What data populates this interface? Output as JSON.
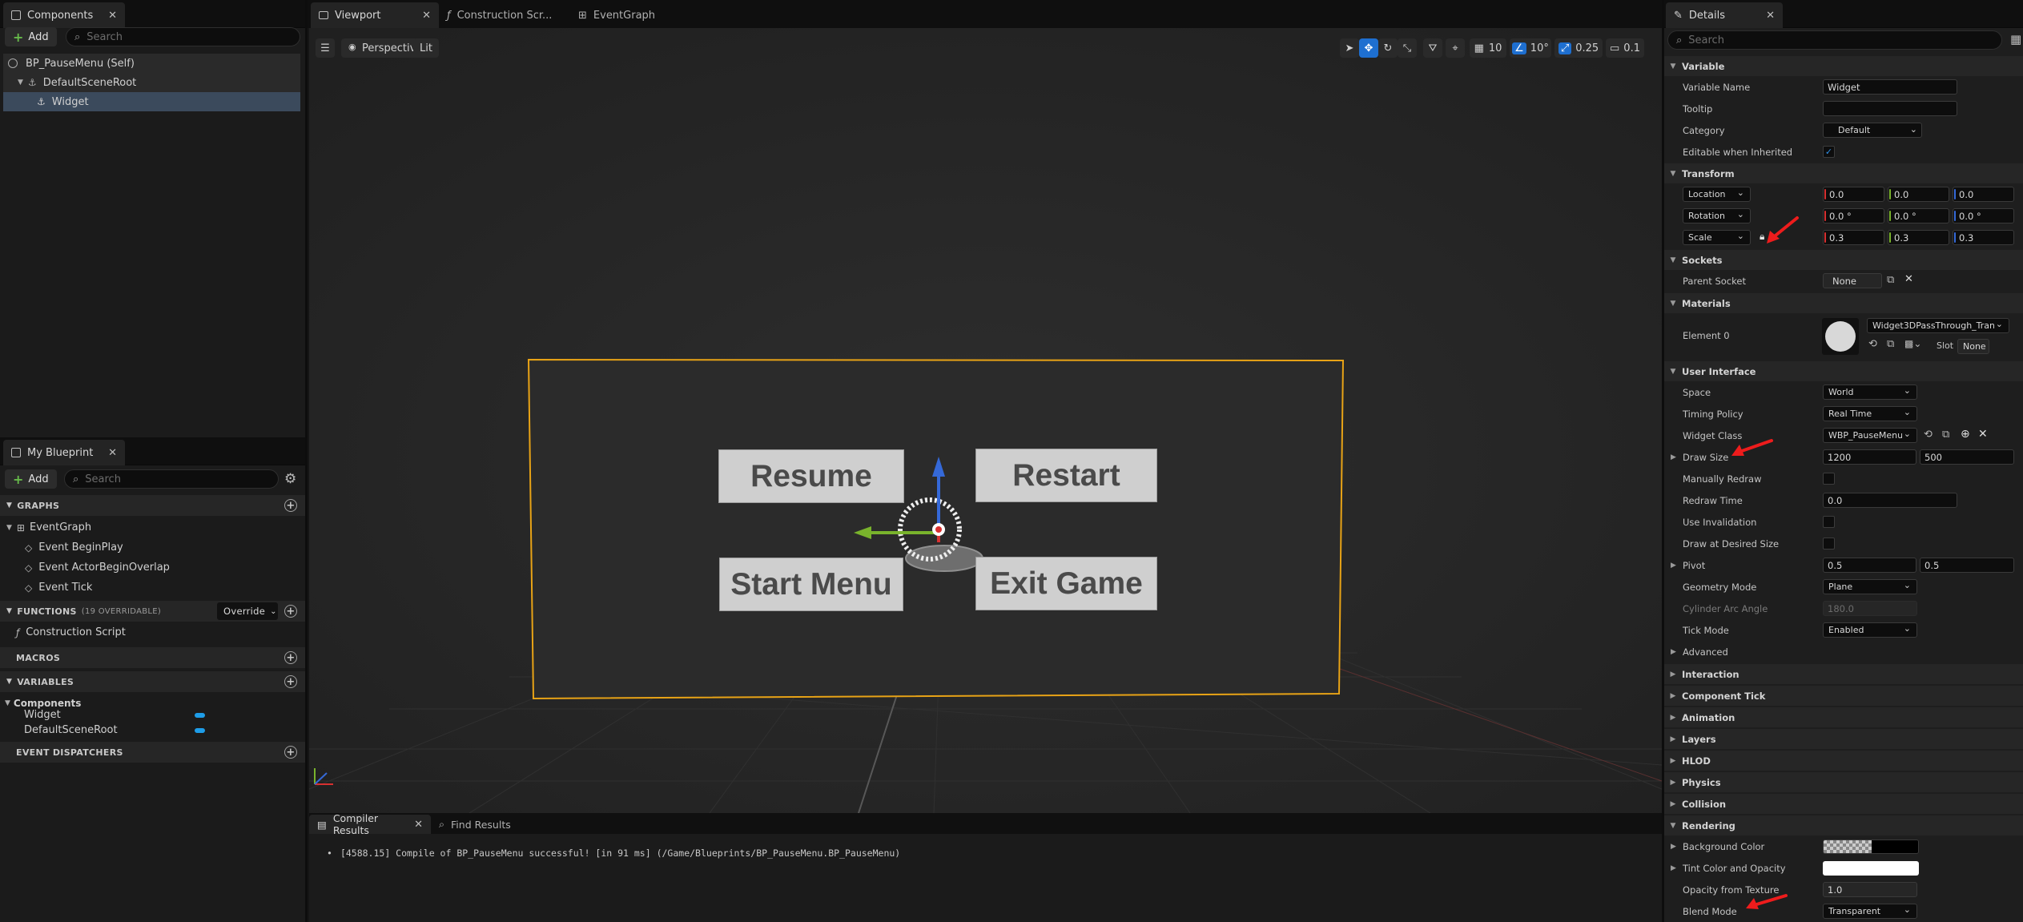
{
  "components_panel": {
    "tab_label": "Components",
    "add_label": "Add",
    "search_placeholder": "Search",
    "tree": [
      {
        "label": "BP_PauseMenu (Self)"
      },
      {
        "label": "DefaultSceneRoot"
      },
      {
        "label": "Widget"
      }
    ]
  },
  "my_blueprint": {
    "tab_label": "My Blueprint",
    "add_label": "Add",
    "search_placeholder": "Search",
    "graphs_header": "GRAPHS",
    "event_graph": "EventGraph",
    "events": [
      "Event BeginPlay",
      "Event ActorBeginOverlap",
      "Event Tick"
    ],
    "functions_header": "FUNCTIONS",
    "functions_count": "(19 OVERRIDABLE)",
    "override_label": "Override",
    "construction_script": "Construction Script",
    "macros_header": "MACROS",
    "variables_header": "VARIABLES",
    "components_group": "Components",
    "variables": [
      "Widget",
      "DefaultSceneRoot"
    ],
    "dispatchers_header": "EVENT DISPATCHERS"
  },
  "editor_tabs": [
    "Viewport",
    "Construction Scr...",
    "EventGraph"
  ],
  "viewport": {
    "perspective_label": "Perspective",
    "lit_label": "Lit",
    "grid_snap": "10",
    "rot_snap": "10°",
    "scale_snap": "0.25",
    "cam_speed": "0.1",
    "widget_buttons": [
      "Resume",
      "Restart",
      "Start Menu",
      "Exit Game"
    ]
  },
  "bottom_panel": {
    "tabs": [
      "Compiler Results",
      "Find Results"
    ],
    "log_line": "[4588.15] Compile of BP_PauseMenu successful! [in 91 ms] (/Game/Blueprints/BP_PauseMenu.BP_PauseMenu)"
  },
  "details": {
    "tab_label": "Details",
    "search_placeholder": "Search",
    "sections": {
      "variable": "Variable",
      "transform": "Transform",
      "sockets": "Sockets",
      "materials": "Materials",
      "user_interface": "User Interface",
      "rendering": "Rendering"
    },
    "variable_name_label": "Variable Name",
    "variable_name_value": "Widget",
    "tooltip_label": "Tooltip",
    "category_label": "Category",
    "category_value": "Default",
    "editable_label": "Editable when Inherited",
    "location_label": "Location",
    "location": [
      "0.0",
      "0.0",
      "0.0"
    ],
    "rotation_label": "Rotation",
    "rotation": [
      "0.0 °",
      "0.0 °",
      "0.0 °"
    ],
    "scale_label": "Scale",
    "scale": [
      "0.3",
      "0.3",
      "0.3"
    ],
    "parent_socket_label": "Parent Socket",
    "parent_socket_value": "None",
    "element0_label": "Element 0",
    "material_value": "Widget3DPassThrough_Tran",
    "slot_label": "Slot",
    "slot_value": "None",
    "space_label": "Space",
    "space_value": "World",
    "timing_label": "Timing Policy",
    "timing_value": "Real Time",
    "widget_class_label": "Widget Class",
    "widget_class_value": "WBP_PauseMenu",
    "draw_size_label": "Draw Size",
    "draw_size": [
      "1200",
      "500"
    ],
    "manually_redraw_label": "Manually Redraw",
    "redraw_time_label": "Redraw Time",
    "redraw_time_value": "0.0",
    "use_invalidation_label": "Use Invalidation",
    "draw_desired_label": "Draw at Desired Size",
    "pivot_label": "Pivot",
    "pivot": [
      "0.5",
      "0.5"
    ],
    "geometry_label": "Geometry Mode",
    "geometry_value": "Plane",
    "cylinder_label": "Cylinder Arc Angle",
    "cylinder_value": "180.0",
    "tick_mode_label": "Tick Mode",
    "tick_mode_value": "Enabled",
    "advanced_label": "Advanced",
    "collapsed_sections": [
      "Interaction",
      "Component Tick",
      "Animation",
      "Layers",
      "HLOD",
      "Physics",
      "Collision"
    ],
    "bg_color_label": "Background Color",
    "tint_label": "Tint Color and Opacity",
    "opacity_tex_label": "Opacity from Texture",
    "opacity_tex_value": "1.0",
    "blend_mode_label": "Blend Mode",
    "blend_mode_value": "Transparent"
  }
}
